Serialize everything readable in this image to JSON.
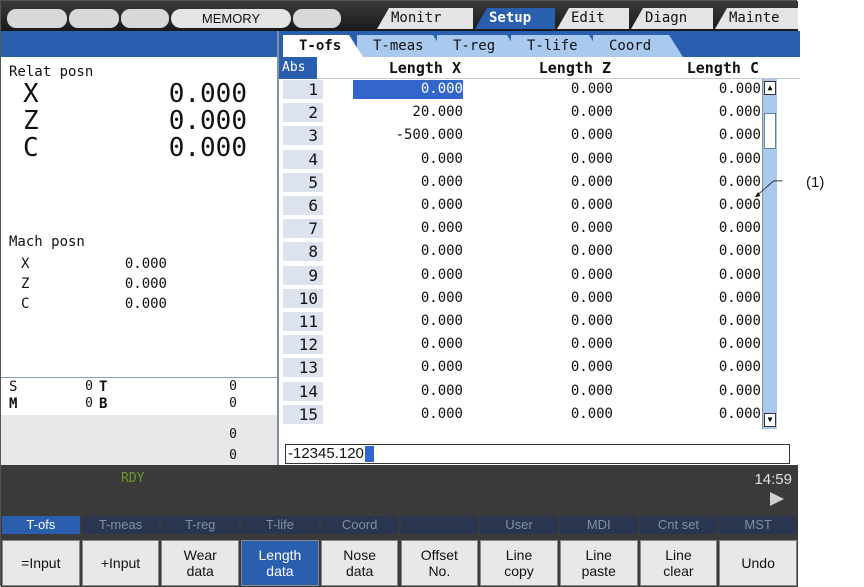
{
  "topbar": {
    "mode": "MEMORY",
    "tabs": [
      {
        "label": "Monitr",
        "active": false
      },
      {
        "label": "Setup",
        "active": true
      },
      {
        "label": "Edit",
        "active": false
      },
      {
        "label": "Diagn",
        "active": false
      },
      {
        "label": "Mainte",
        "active": false
      }
    ]
  },
  "left": {
    "relat_title": "Relat posn",
    "relat": [
      {
        "axis": "X",
        "value": "0.000"
      },
      {
        "axis": "Z",
        "value": "0.000"
      },
      {
        "axis": "C",
        "value": "0.000"
      }
    ],
    "mach_title": "Mach posn",
    "mach": [
      {
        "axis": "X",
        "value": "0.000"
      },
      {
        "axis": "Z",
        "value": "0.000"
      },
      {
        "axis": "C",
        "value": "0.000"
      }
    ],
    "s_label": "S",
    "s_value": "0",
    "t_label": "T",
    "t_value": "0",
    "m_label": "M",
    "m_value": "0",
    "b_label": "B",
    "b_value": "0",
    "extra1": "0",
    "extra2": "0"
  },
  "subtabs": [
    "T-ofs",
    "T-meas",
    "T-reg",
    "T-life",
    "Coord"
  ],
  "table": {
    "abs": "Abs",
    "headers": [
      "Length X",
      "Length Z",
      "Length C"
    ],
    "rows": [
      {
        "no": "1",
        "x": "0.000",
        "z": "0.000",
        "c": "0.000"
      },
      {
        "no": "2",
        "x": "20.000",
        "z": "0.000",
        "c": "0.000"
      },
      {
        "no": "3",
        "x": "-500.000",
        "z": "0.000",
        "c": "0.000"
      },
      {
        "no": "4",
        "x": "0.000",
        "z": "0.000",
        "c": "0.000"
      },
      {
        "no": "5",
        "x": "0.000",
        "z": "0.000",
        "c": "0.000"
      },
      {
        "no": "6",
        "x": "0.000",
        "z": "0.000",
        "c": "0.000"
      },
      {
        "no": "7",
        "x": "0.000",
        "z": "0.000",
        "c": "0.000"
      },
      {
        "no": "8",
        "x": "0.000",
        "z": "0.000",
        "c": "0.000"
      },
      {
        "no": "9",
        "x": "0.000",
        "z": "0.000",
        "c": "0.000"
      },
      {
        "no": "10",
        "x": "0.000",
        "z": "0.000",
        "c": "0.000"
      },
      {
        "no": "11",
        "x": "0.000",
        "z": "0.000",
        "c": "0.000"
      },
      {
        "no": "12",
        "x": "0.000",
        "z": "0.000",
        "c": "0.000"
      },
      {
        "no": "13",
        "x": "0.000",
        "z": "0.000",
        "c": "0.000"
      },
      {
        "no": "14",
        "x": "0.000",
        "z": "0.000",
        "c": "0.000"
      },
      {
        "no": "15",
        "x": "0.000",
        "z": "0.000",
        "c": "0.000"
      }
    ],
    "input_value": "-12345.120"
  },
  "status": {
    "rdy": "RDY",
    "clock": "14:59"
  },
  "menu_top": [
    {
      "label": "T-ofs",
      "on": true
    },
    {
      "label": "T-meas",
      "on": false
    },
    {
      "label": "T-reg",
      "on": false
    },
    {
      "label": "T-life",
      "on": false
    },
    {
      "label": "Coord",
      "on": false
    },
    {
      "label": "",
      "on": false
    },
    {
      "label": "User",
      "on": false
    },
    {
      "label": "MDI",
      "on": false
    },
    {
      "label": "Cnt set",
      "on": false
    },
    {
      "label": "MST",
      "on": false
    }
  ],
  "menu_bottom": [
    {
      "l1": "=Input",
      "l2": "",
      "on": false
    },
    {
      "l1": "+Input",
      "l2": "",
      "on": false
    },
    {
      "l1": "Wear",
      "l2": "data",
      "on": false
    },
    {
      "l1": "Length",
      "l2": "data",
      "on": true
    },
    {
      "l1": "Nose",
      "l2": "data",
      "on": false
    },
    {
      "l1": "Offset",
      "l2": "No.",
      "on": false
    },
    {
      "l1": "Line",
      "l2": "copy",
      "on": false
    },
    {
      "l1": "Line",
      "l2": "paste",
      "on": false
    },
    {
      "l1": "Line",
      "l2": "clear",
      "on": false
    },
    {
      "l1": "Undo",
      "l2": "",
      "on": false
    }
  ],
  "callout": "(1)"
}
